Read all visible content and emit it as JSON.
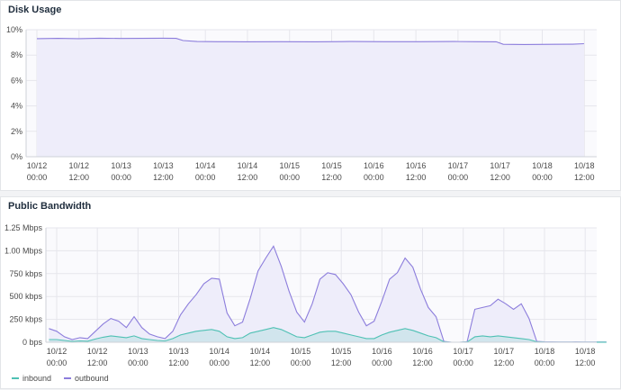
{
  "colors": {
    "inbound": "#4fc1b4",
    "outbound": "#8c7ddc",
    "fill": "#eeedfa",
    "grid": "#e6e6ec"
  },
  "chart_data": [
    {
      "type": "area",
      "title": "Disk Usage",
      "x_range": [
        "10/12 00:00",
        "10/18 18:00"
      ],
      "x_ticks": [
        [
          "10/12",
          "00:00"
        ],
        [
          "10/12",
          "12:00"
        ],
        [
          "10/13",
          "00:00"
        ],
        [
          "10/13",
          "12:00"
        ],
        [
          "10/14",
          "00:00"
        ],
        [
          "10/14",
          "12:00"
        ],
        [
          "10/15",
          "00:00"
        ],
        [
          "10/15",
          "12:00"
        ],
        [
          "10/16",
          "00:00"
        ],
        [
          "10/16",
          "12:00"
        ],
        [
          "10/17",
          "00:00"
        ],
        [
          "10/17",
          "12:00"
        ],
        [
          "10/18",
          "00:00"
        ],
        [
          "10/18",
          "12:00"
        ]
      ],
      "y_ticks": [
        "0%",
        "2%",
        "4%",
        "6%",
        "8%",
        "10%"
      ],
      "ylim": [
        0,
        10
      ],
      "series": [
        {
          "color": "outbound",
          "points": [
            [
              0,
              9.3
            ],
            [
              3,
              9.32
            ],
            [
              6,
              9.3
            ],
            [
              9,
              9.33
            ],
            [
              12,
              9.31
            ],
            [
              15,
              9.32
            ],
            [
              18,
              9.33
            ],
            [
              20,
              9.32
            ],
            [
              21,
              9.15
            ],
            [
              23,
              9.07
            ],
            [
              26,
              9.06
            ],
            [
              30,
              9.05
            ],
            [
              35,
              9.06
            ],
            [
              40,
              9.05
            ],
            [
              45,
              9.07
            ],
            [
              50,
              9.06
            ],
            [
              55,
              9.06
            ],
            [
              60,
              9.07
            ],
            [
              63,
              9.06
            ],
            [
              66,
              9.05
            ],
            [
              67,
              8.85
            ],
            [
              70,
              8.84
            ],
            [
              74,
              8.85
            ],
            [
              77,
              8.86
            ],
            [
              78.6,
              8.9
            ]
          ]
        }
      ]
    },
    {
      "type": "area",
      "title": "Public Bandwidth",
      "x_range": [
        "10/12 00:00",
        "10/18 18:00"
      ],
      "x_ticks": [
        [
          "10/12",
          "00:00"
        ],
        [
          "10/12",
          "12:00"
        ],
        [
          "10/13",
          "00:00"
        ],
        [
          "10/13",
          "12:00"
        ],
        [
          "10/14",
          "00:00"
        ],
        [
          "10/14",
          "12:00"
        ],
        [
          "10/15",
          "00:00"
        ],
        [
          "10/15",
          "12:00"
        ],
        [
          "10/16",
          "00:00"
        ],
        [
          "10/16",
          "12:00"
        ],
        [
          "10/17",
          "00:00"
        ],
        [
          "10/17",
          "12:00"
        ],
        [
          "10/18",
          "00:00"
        ],
        [
          "10/18",
          "12:00"
        ]
      ],
      "y_ticks": [
        "0 bps",
        "250 kbps",
        "500 kbps",
        "750 kbps",
        "1.00 Mbps",
        "1.25 Mbps"
      ],
      "ylim": [
        0,
        1250
      ],
      "y_unit": "kbps",
      "legend": [
        "inbound",
        "outbound"
      ],
      "series": [
        {
          "name": "outbound",
          "color": "outbound",
          "points": [
            [
              -1,
              150
            ],
            [
              0,
              120
            ],
            [
              1,
              60
            ],
            [
              2,
              30
            ],
            [
              3,
              50
            ],
            [
              4,
              40
            ],
            [
              5,
              120
            ],
            [
              6,
              200
            ],
            [
              7,
              260
            ],
            [
              8,
              230
            ],
            [
              9,
              160
            ],
            [
              10,
              280
            ],
            [
              11,
              160
            ],
            [
              12,
              90
            ],
            [
              13,
              60
            ],
            [
              14,
              40
            ],
            [
              15,
              120
            ],
            [
              16,
              300
            ],
            [
              17,
              420
            ],
            [
              18,
              520
            ],
            [
              19,
              640
            ],
            [
              20,
              700
            ],
            [
              21,
              690
            ],
            [
              22,
              320
            ],
            [
              23,
              180
            ],
            [
              24,
              220
            ],
            [
              25,
              480
            ],
            [
              26,
              780
            ],
            [
              27,
              920
            ],
            [
              28,
              1050
            ],
            [
              29,
              830
            ],
            [
              30,
              560
            ],
            [
              31,
              330
            ],
            [
              32,
              220
            ],
            [
              33,
              420
            ],
            [
              34,
              690
            ],
            [
              35,
              760
            ],
            [
              36,
              740
            ],
            [
              37,
              640
            ],
            [
              38,
              520
            ],
            [
              39,
              330
            ],
            [
              40,
              180
            ],
            [
              41,
              230
            ],
            [
              42,
              450
            ],
            [
              43,
              690
            ],
            [
              44,
              760
            ],
            [
              45,
              920
            ],
            [
              46,
              820
            ],
            [
              47,
              580
            ],
            [
              48,
              380
            ],
            [
              49,
              280
            ],
            [
              50,
              10
            ],
            [
              51,
              0
            ],
            [
              52,
              0
            ],
            [
              53,
              5
            ],
            [
              54,
              360
            ],
            [
              55,
              380
            ],
            [
              56,
              400
            ],
            [
              57,
              470
            ],
            [
              58,
              420
            ],
            [
              59,
              360
            ],
            [
              60,
              420
            ],
            [
              61,
              260
            ],
            [
              62,
              10
            ],
            [
              63,
              5
            ],
            [
              64,
              3
            ],
            [
              65,
              2
            ],
            [
              66,
              2
            ],
            [
              67,
              3
            ],
            [
              68,
              2
            ],
            [
              69,
              2
            ],
            [
              70,
              2
            ],
            [
              71,
              2
            ]
          ]
        },
        {
          "name": "inbound",
          "color": "inbound",
          "points": [
            [
              -1,
              30
            ],
            [
              0,
              30
            ],
            [
              1,
              20
            ],
            [
              2,
              10
            ],
            [
              3,
              15
            ],
            [
              4,
              12
            ],
            [
              5,
              35
            ],
            [
              6,
              55
            ],
            [
              7,
              70
            ],
            [
              8,
              60
            ],
            [
              9,
              50
            ],
            [
              10,
              70
            ],
            [
              11,
              40
            ],
            [
              12,
              30
            ],
            [
              13,
              20
            ],
            [
              14,
              15
            ],
            [
              15,
              40
            ],
            [
              16,
              80
            ],
            [
              17,
              100
            ],
            [
              18,
              120
            ],
            [
              19,
              130
            ],
            [
              20,
              140
            ],
            [
              21,
              120
            ],
            [
              22,
              60
            ],
            [
              23,
              40
            ],
            [
              24,
              50
            ],
            [
              25,
              100
            ],
            [
              26,
              120
            ],
            [
              27,
              140
            ],
            [
              28,
              160
            ],
            [
              29,
              140
            ],
            [
              30,
              100
            ],
            [
              31,
              60
            ],
            [
              32,
              50
            ],
            [
              33,
              80
            ],
            [
              34,
              110
            ],
            [
              35,
              120
            ],
            [
              36,
              120
            ],
            [
              37,
              100
            ],
            [
              38,
              80
            ],
            [
              39,
              60
            ],
            [
              40,
              40
            ],
            [
              41,
              40
            ],
            [
              42,
              80
            ],
            [
              43,
              110
            ],
            [
              44,
              130
            ],
            [
              45,
              150
            ],
            [
              46,
              130
            ],
            [
              47,
              100
            ],
            [
              48,
              70
            ],
            [
              49,
              50
            ],
            [
              50,
              5
            ],
            [
              51,
              0
            ],
            [
              52,
              0
            ],
            [
              53,
              3
            ],
            [
              54,
              60
            ],
            [
              55,
              70
            ],
            [
              56,
              60
            ],
            [
              57,
              70
            ],
            [
              58,
              60
            ],
            [
              59,
              50
            ],
            [
              60,
              40
            ],
            [
              61,
              30
            ],
            [
              62,
              5
            ],
            [
              63,
              2
            ],
            [
              64,
              1
            ],
            [
              65,
              1
            ],
            [
              66,
              1
            ],
            [
              67,
              1
            ],
            [
              68,
              1
            ],
            [
              69,
              1
            ],
            [
              70,
              1
            ],
            [
              71,
              1
            ]
          ]
        }
      ]
    }
  ]
}
